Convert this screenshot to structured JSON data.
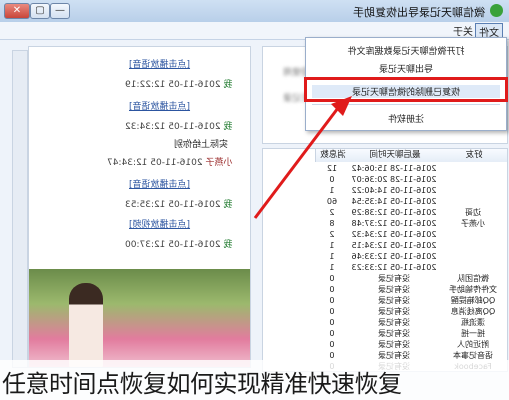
{
  "window": {
    "title": "微信聊天记录导出恢复助手",
    "btn_min": "—",
    "btn_max": "▢",
    "btn_close": "✕"
  },
  "menu": {
    "items": [
      "文件",
      "关于"
    ]
  },
  "dropdown": {
    "items": [
      "打开微信聊天记录数据库文件",
      "导出聊天记录",
      "恢复已删除的微信聊天记录",
      "注册软件"
    ]
  },
  "chat": {
    "messages": [
      {
        "link": "[点击播放语音]",
        "meta_who": "我",
        "meta_time": "2016-11-05 12:22:19"
      },
      {
        "link": "[点击播放语音]",
        "meta_who": "我",
        "meta_time": "2016-11-05 12:34:32"
      },
      {
        "text": "实际上给你别",
        "meta_who": "小燕子",
        "meta_time": "2016-11-05 12:34:47",
        "other": true
      },
      {
        "link": "[点击播放语音]",
        "meta_who": "我",
        "meta_time": "2016-11-05 12:35:53"
      },
      {
        "link": "[点击播放视频]",
        "meta_who": "我",
        "meta_time": "2016-11-05 12:37:00"
      }
    ]
  },
  "right_panel": {
    "blur1": "欢迎使用",
    "blur2": "微信聊天记录"
  },
  "grid": {
    "headers": [
      "好友",
      "最后聊天时间",
      "消息数"
    ],
    "rows": [
      [
        "",
        "2016-11-28 15:06:42",
        "12"
      ],
      [
        "",
        "2016-11-28 20:36:07",
        "0"
      ],
      [
        "",
        "2016-11-05 14:40:22",
        "1"
      ],
      [
        "",
        "2016-11-05 14:35:54",
        "60"
      ],
      [
        "边哥",
        "2016-11-05 12:38:29",
        "2"
      ],
      [
        "小燕子",
        "2016-11-05 12:37:48",
        "8"
      ],
      [
        "",
        "2016-11-05 12:34:32",
        "2"
      ],
      [
        "",
        "2016-11-05 12:34:15",
        "1"
      ],
      [
        "",
        "2016-11-05 12:33:46",
        "1"
      ],
      [
        "",
        "2016-11-05 12:33:23",
        "1"
      ],
      [
        "微信团队",
        "没有记录",
        "0"
      ],
      [
        "文件传输助手",
        "没有记录",
        "0"
      ],
      [
        "QQ邮箱提醒",
        "没有记录",
        "0"
      ],
      [
        "QQ离线消息",
        "没有记录",
        "0"
      ],
      [
        "漂流瓶",
        "没有记录",
        "0"
      ],
      [
        "摇一摇",
        "没有记录",
        "0"
      ],
      [
        "附近的人",
        "没有记录",
        "0"
      ],
      [
        "语音记事本",
        "没有记录",
        "0"
      ],
      [
        "Facebook",
        "没有记录",
        "0"
      ]
    ]
  },
  "caption": "任意时间点恢复如何实现精准快速恢复"
}
